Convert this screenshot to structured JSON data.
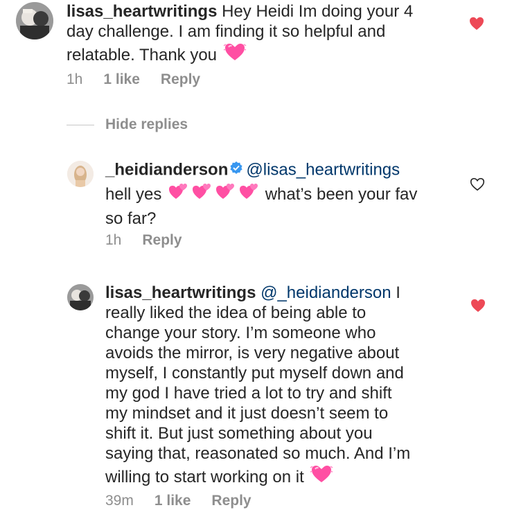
{
  "comments": [
    {
      "username": "lisas_heartwritings",
      "text_line1": " Hey Heidi Im doing your 4",
      "text_line2": "day challenge. I am finding it so helpful and",
      "text_line3": "relatable. Thank you",
      "time": "1h",
      "likes": "1 like",
      "reply": "Reply",
      "liked": true,
      "avatar_icon": "profile-photo"
    }
  ],
  "thread": {
    "hide_replies": "Hide replies"
  },
  "replies": [
    {
      "username": "_heidianderson",
      "verified": true,
      "mention": "@lisas_heartwritings",
      "text_a": "hell yes",
      "text_b": " what’s been your fav",
      "text_c": "so far?",
      "time": "1h",
      "reply": "Reply",
      "liked": false
    },
    {
      "username": "lisas_heartwritings",
      "mention": "@_heidianderson",
      "text_after_mention": " I",
      "lines": [
        "really liked the idea of being able to",
        "change your story. I’m someone who",
        "avoids the mirror, is very negative about",
        "myself, I constantly put myself down and",
        "my god I have tried a lot to try and shift",
        "my mindset and it just doesn’t seem to",
        "shift it. But just something about you",
        "saying that, reasonated so much. And I’m",
        "willing to start working on it"
      ],
      "time": "39m",
      "likes": "1 like",
      "reply": "Reply",
      "liked": true
    }
  ],
  "colors": {
    "text": "#262626",
    "meta": "#8e8e8e",
    "mention": "#00376b",
    "heart_liked": "#ed4956",
    "verified": "#3897f0",
    "emoji_heart": "#ff4fa3"
  },
  "icons": {
    "liked": "heart-filled-icon",
    "unliked": "heart-outline-icon",
    "verified": "verified-badge-icon",
    "emoji": "two-hearts-emoji"
  }
}
